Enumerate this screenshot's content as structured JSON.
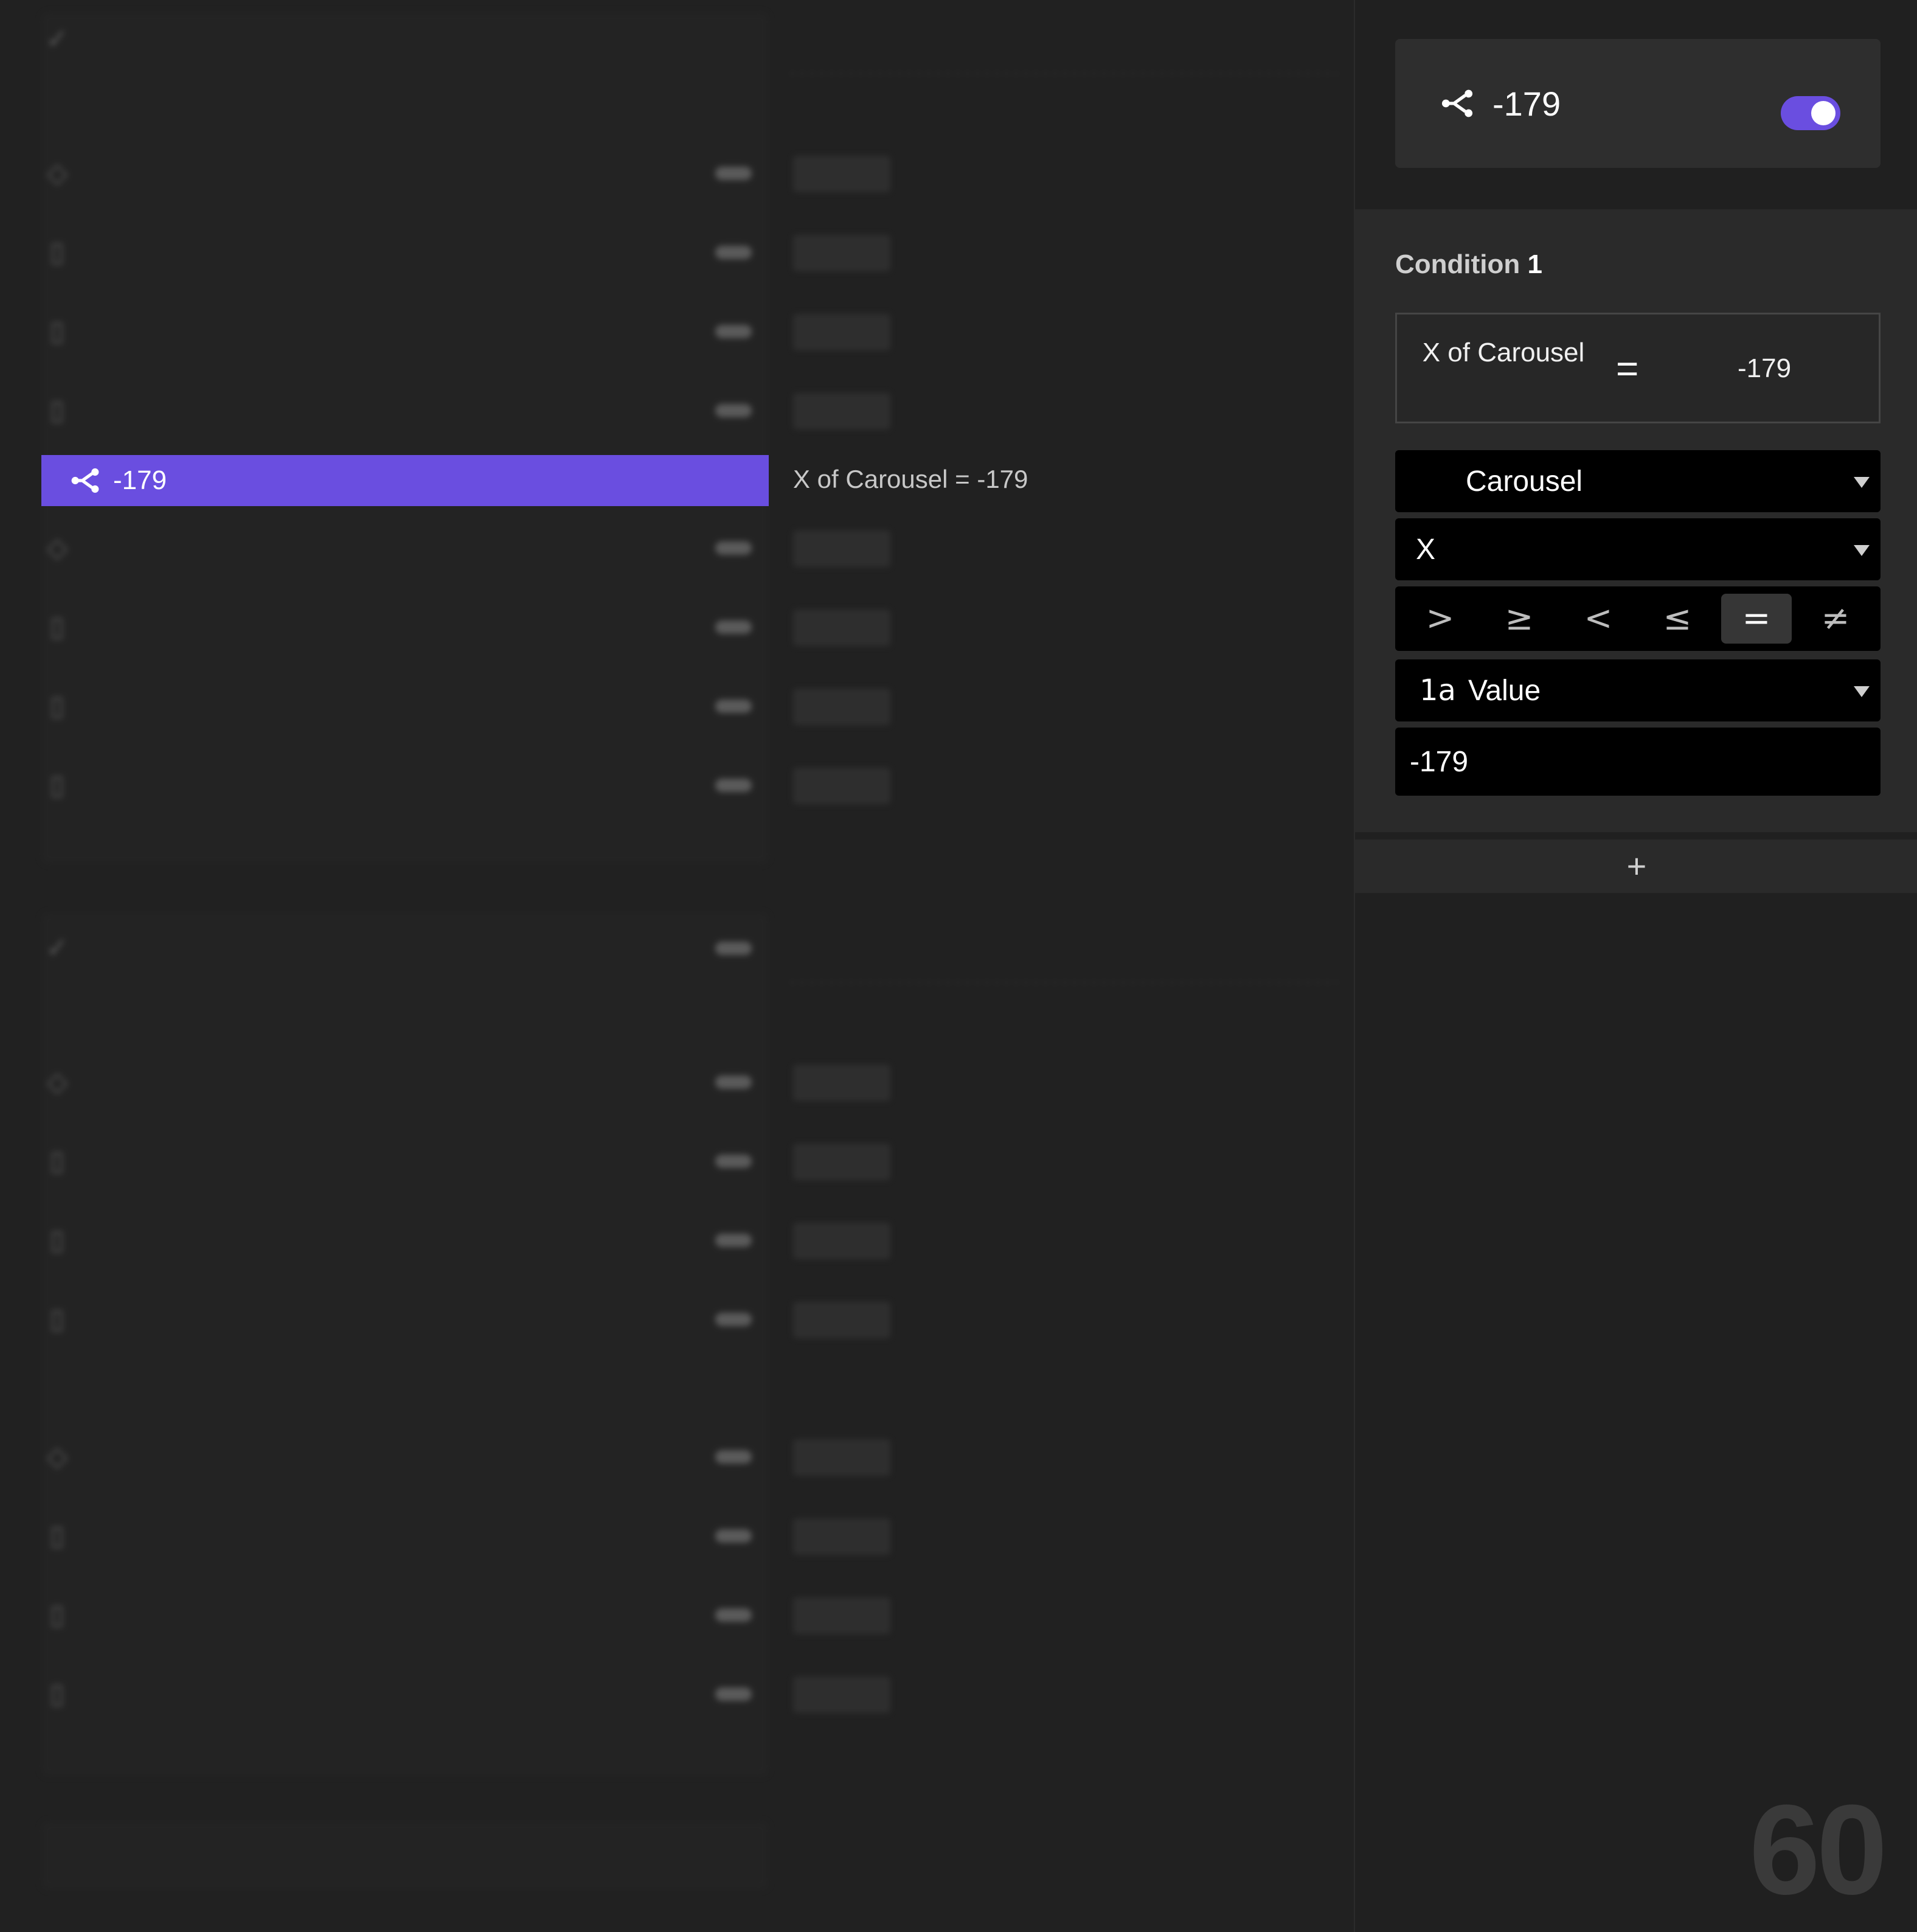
{
  "left": {
    "selected_row": {
      "label": "-179",
      "icon": "branch-icon"
    },
    "selected_condition_text": "X of Carousel = -179"
  },
  "panel": {
    "header": {
      "title": "-179",
      "icon": "branch-icon",
      "enabled": true
    },
    "condition": {
      "title_word": "Condition",
      "title_num": "1",
      "summary": {
        "left": "X of Carousel",
        "operator": "=",
        "right": "-179"
      },
      "layer_select": "Carousel",
      "property_select": "X",
      "operators": [
        ">",
        "≥",
        "<",
        "≤",
        "=",
        "≠"
      ],
      "active_operator": "=",
      "source_icon": "1a",
      "source_select": "Value",
      "value": "-179"
    },
    "add_label": "+"
  },
  "fps": "60",
  "colors": {
    "accent": "#6a4ee0",
    "panel_bg": "#202020",
    "card_bg": "#2e2e2e",
    "input_bg": "#000000"
  }
}
